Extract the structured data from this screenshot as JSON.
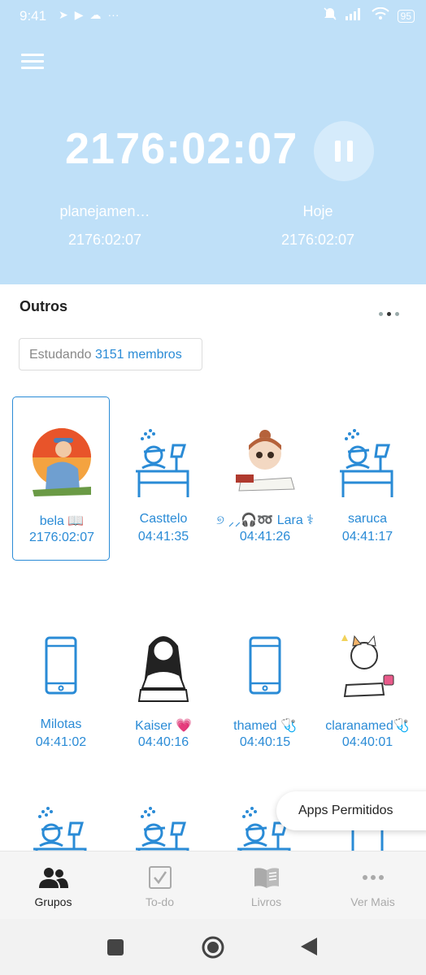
{
  "status": {
    "time": "9:41",
    "battery": "95"
  },
  "timer": {
    "main": "2176:02:07"
  },
  "stats": [
    {
      "label": "planejamen…",
      "value": "2176:02:07"
    },
    {
      "label": "Hoje",
      "value": "2176:02:07"
    }
  ],
  "section": {
    "title": "Outros"
  },
  "chip": {
    "prefix": "Estudando",
    "count": "3151 membros"
  },
  "members": [
    {
      "name": "bela 📖",
      "time": "2176:02:07",
      "avatar": "nurse-illustration",
      "selected": true
    },
    {
      "name": "Casttelo",
      "time": "04:41:35",
      "avatar": "desk-study-icon"
    },
    {
      "name": "୭ ⸝⸝🎧➿ Lara ⚕",
      "time": "04:41:26",
      "avatar": "girl-studying-illustration"
    },
    {
      "name": "saruca",
      "time": "04:41:17",
      "avatar": "desk-study-icon"
    },
    {
      "name": "Milotas",
      "time": "04:41:02",
      "avatar": "phone-icon"
    },
    {
      "name": "Kaiser 💗",
      "time": "04:40:16",
      "avatar": "anime-girl-reading-illustration"
    },
    {
      "name": "thamed 🩺",
      "time": "04:40:15",
      "avatar": "phone-icon"
    },
    {
      "name": "claranamed🩺",
      "time": "04:40:01",
      "avatar": "cat-reading-illustration"
    },
    {
      "name": "",
      "time": "",
      "avatar": "desk-study-icon"
    },
    {
      "name": "",
      "time": "",
      "avatar": "desk-study-icon"
    },
    {
      "name": "",
      "time": "",
      "avatar": "desk-study-icon"
    },
    {
      "name": "",
      "time": "",
      "avatar": "phone-icon"
    }
  ],
  "popup": {
    "label": "Apps Permitidos"
  },
  "tabs": [
    {
      "label": "Grupos",
      "icon": "group-icon",
      "active": true
    },
    {
      "label": "To-do",
      "icon": "checkbox-icon"
    },
    {
      "label": "Livros",
      "icon": "book-icon"
    },
    {
      "label": "Ver Mais",
      "icon": "more-dots-icon"
    }
  ],
  "colors": {
    "header": "#bfe0f8",
    "accent": "#2a8bd6"
  }
}
